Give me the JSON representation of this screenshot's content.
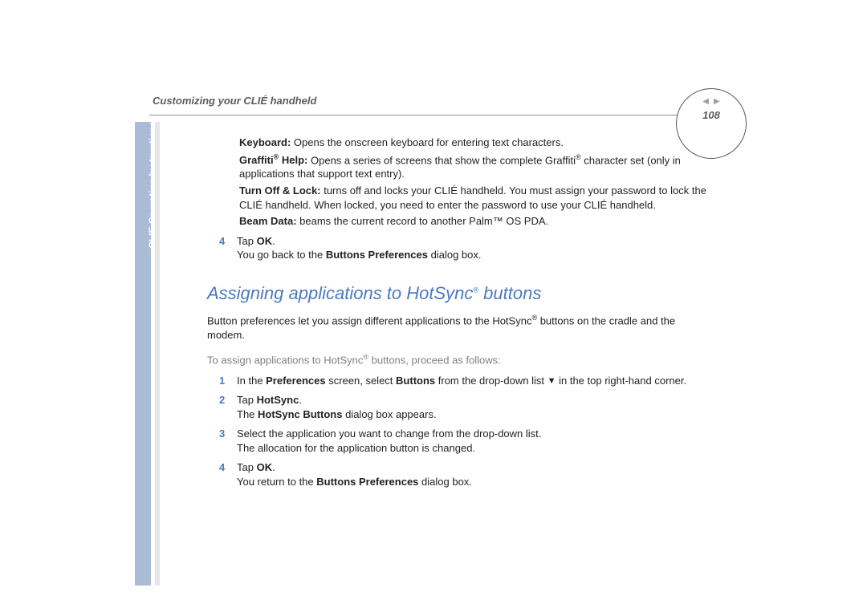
{
  "header": {
    "chapter_title": "Customizing your CLIÉ handheld",
    "page_number": "108"
  },
  "sidebar": {
    "label": "CLIE Operating Instructions"
  },
  "nav": {
    "prev_icon": "◀",
    "next_icon": "▶"
  },
  "definitions": [
    {
      "term": "Keyboard:",
      "text": " Opens the onscreen keyboard for entering text characters."
    },
    {
      "term_html": "graffiti_help",
      "text": " Opens a series of screens that show the complete Graffiti",
      "sup": "®",
      "text2": " character set (only in applications that support text entry)."
    },
    {
      "term": "Turn Off & Lock:",
      "text": " turns off and locks your CLIÉ handheld. You must assign your password to lock the CLIÉ handheld. When locked, you need to enter the password to use your CLIÉ handheld."
    },
    {
      "term": "Beam Data:",
      "text": " beams the current record to another Palm™ OS PDA."
    }
  ],
  "graffiti_term": {
    "prefix": "Graffiti",
    "sup": "®",
    "suffix": " Help:"
  },
  "step4a": {
    "num": "4",
    "line1_pre": "Tap ",
    "line1_bold": "OK",
    "line1_post": ".",
    "line2_pre": "You go back to the ",
    "line2_bold": "Buttons Preferences",
    "line2_post": " dialog box."
  },
  "section_title": {
    "pre": "Assigning applications to HotSync",
    "sup": "®",
    "post": " buttons"
  },
  "section_intro": {
    "pre": "Button preferences let you assign different applications to the HotSync",
    "sup": "®",
    "post": " buttons on the cradle and the modem."
  },
  "proceed_text": {
    "pre": "To assign applications to HotSync",
    "sup": "®",
    "post": " buttons, proceed as follows:"
  },
  "steps": [
    {
      "num": "1",
      "parts": [
        "In the ",
        "Preferences",
        " screen, select ",
        "Buttons",
        " from the drop-down list ",
        "▼",
        " in the top right-hand corner."
      ]
    },
    {
      "num": "2",
      "line1_pre": "Tap ",
      "line1_bold": "HotSync",
      "line1_post": ".",
      "line2_pre": "The ",
      "line2_bold": "HotSync Buttons",
      "line2_post": " dialog box appears."
    },
    {
      "num": "3",
      "line1": "Select the application you want to change from the drop-down list.",
      "line2": "The allocation for the application button is changed."
    },
    {
      "num": "4",
      "line1_pre": "Tap ",
      "line1_bold": "OK",
      "line1_post": ".",
      "line2_pre": "You return to the ",
      "line2_bold": "Buttons Preferences",
      "line2_post": " dialog box."
    }
  ]
}
